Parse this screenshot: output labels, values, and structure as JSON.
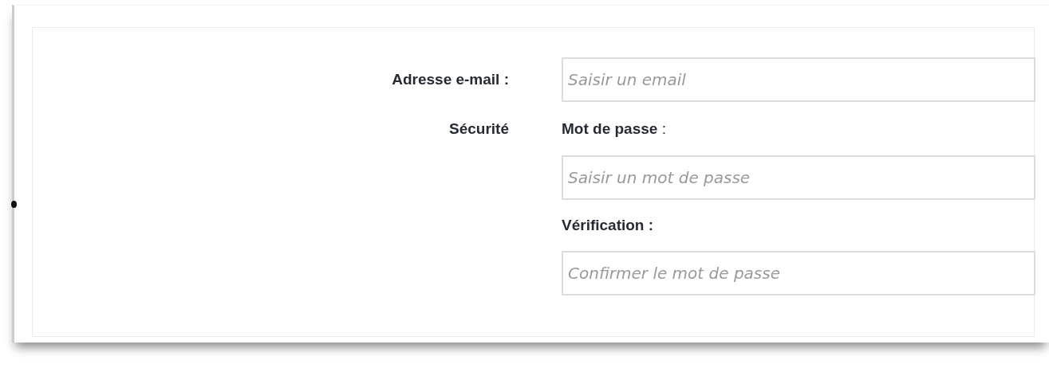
{
  "email": {
    "label": "Adresse e-mail :",
    "placeholder": "Saisir un email"
  },
  "security": {
    "label": "Sécurité",
    "fields": [
      {
        "label": "**Mot de passe** :",
        "placeholder": "Saisir un mot de passe"
      },
      {
        "label": "Vérification :",
        "placeholder": "Confirmer le mot de passe"
      }
    ]
  }
}
